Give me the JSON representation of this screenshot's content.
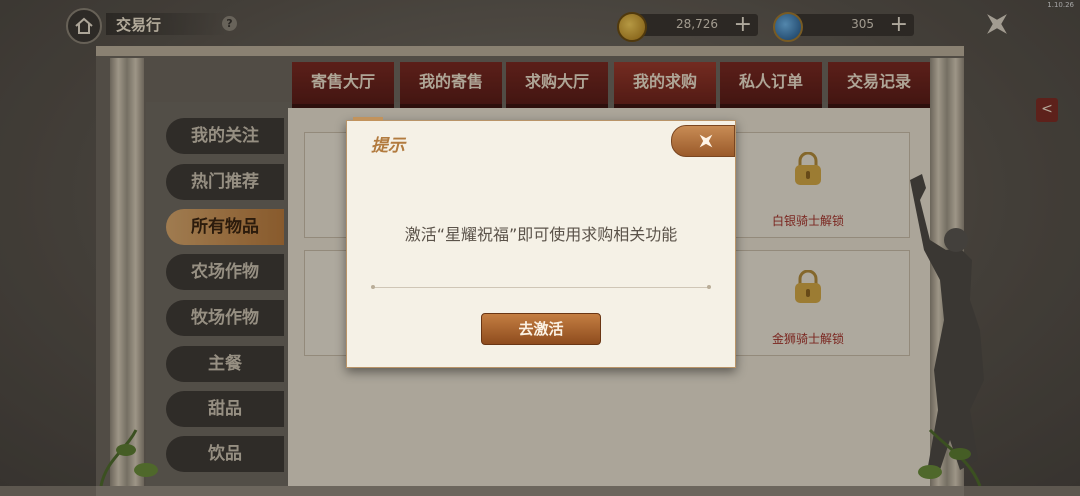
{
  "version": "1.10.26",
  "header": {
    "title": "交易行",
    "help_symbol": "?",
    "gold_amount": "28,726",
    "gem_amount": "305",
    "plus_symbol": "+"
  },
  "tabs": [
    {
      "label": "寄售大厅",
      "active": false
    },
    {
      "label": "我的寄售",
      "active": false
    },
    {
      "label": "求购大厅",
      "active": false
    },
    {
      "label": "我的求购",
      "active": true
    },
    {
      "label": "私人订单",
      "active": false
    },
    {
      "label": "交易记录",
      "active": false
    }
  ],
  "sidebar": [
    {
      "label": "我的关注",
      "active": false
    },
    {
      "label": "热门推荐",
      "active": false
    },
    {
      "label": "所有物品",
      "active": true
    },
    {
      "label": "农场作物",
      "active": false
    },
    {
      "label": "牧场作物",
      "active": false
    },
    {
      "label": "主餐",
      "active": false
    },
    {
      "label": "甜品",
      "active": false
    },
    {
      "label": "饮品",
      "active": false
    }
  ],
  "locked_slots": [
    {
      "label": "白银骑士解锁"
    },
    {
      "label": "金狮骑士解锁"
    }
  ],
  "collapse_arrow": "<",
  "modal": {
    "title": "提示",
    "message": "激活“星耀祝福”即可使用求购相关功能",
    "button_label": "去激活"
  },
  "colors": {
    "tab_red": "#7a2a22",
    "accent_gold": "#c47e42",
    "lock_label": "#a3322a"
  }
}
